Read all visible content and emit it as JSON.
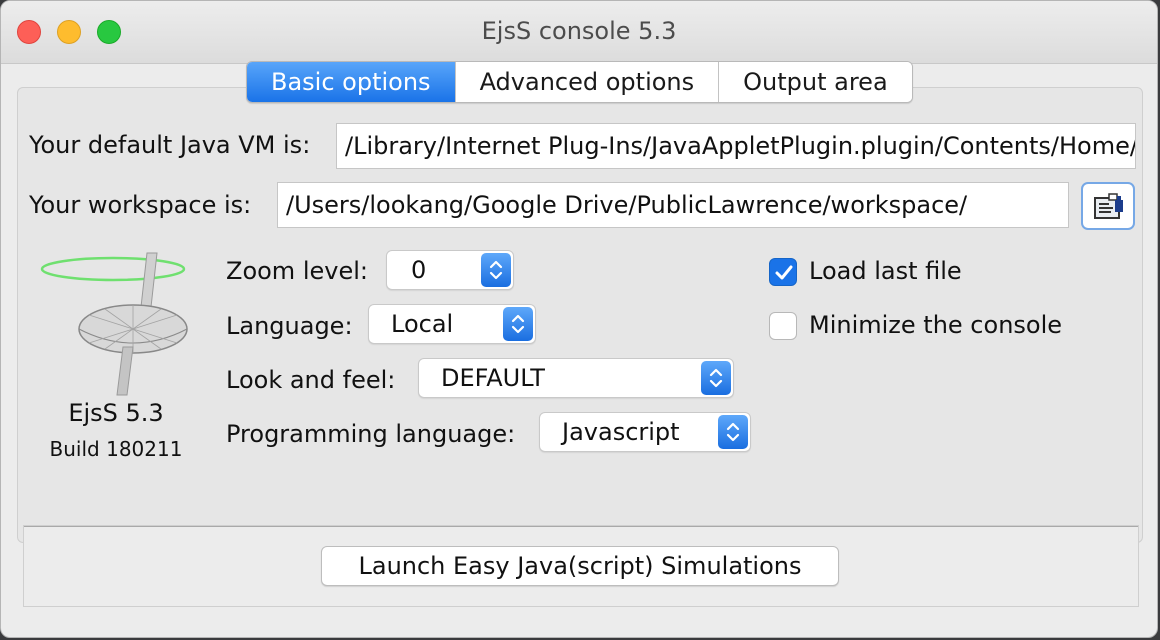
{
  "window": {
    "title": "EjsS console 5.3",
    "buttons": [
      "close",
      "minimize",
      "maximize"
    ]
  },
  "tabs": [
    {
      "label": "Basic options",
      "active": true
    },
    {
      "label": "Advanced options",
      "active": false
    },
    {
      "label": "Output area",
      "active": false
    }
  ],
  "java_vm": {
    "label": "Your default Java VM is:",
    "value": "/Library/Internet Plug-Ins/JavaAppletPlugin.plugin/Contents/Home/bin/java"
  },
  "workspace": {
    "label": "Your workspace is:",
    "value": "/Users/lookang/Google Drive/PublicLawrence/workspace/",
    "browse_icon": "folder-browse-icon"
  },
  "logo": {
    "name": "EjsS 5.3",
    "build": "Build 180211"
  },
  "options": {
    "zoom": {
      "label": "Zoom level:",
      "value": "0"
    },
    "language": {
      "label": "Language:",
      "value": "Local"
    },
    "look_and_feel": {
      "label": "Look and feel:",
      "value": "DEFAULT"
    },
    "programming_language": {
      "label": "Programming language:",
      "value": "Javascript"
    }
  },
  "checkboxes": {
    "load_last_file": {
      "label": "Load last file",
      "checked": true
    },
    "minimize_console": {
      "label": "Minimize the console",
      "checked": false
    }
  },
  "launch_button": "Launch Easy Java(script) Simulations",
  "colors": {
    "accent": "#1a73e8",
    "window_bg": "#ececec",
    "close": "#fd5f57",
    "minimize": "#febc2e",
    "maximize": "#28c840"
  }
}
